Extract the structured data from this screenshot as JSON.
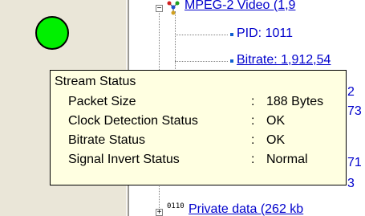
{
  "status_indicator": {
    "color": "#00f000",
    "state": "ok"
  },
  "tree": {
    "stream_node": {
      "label": "MPEG-2 Video (1,9",
      "icon": "network-node-icon"
    },
    "pid": {
      "label": "PID: 1011"
    },
    "bitrate": {
      "label": "Bitrate: 1,912,54"
    },
    "private_data": {
      "label": "Private data (262 kb",
      "icon": "binary-data-icon",
      "icon_text": "0110"
    },
    "partial_right": [
      "2",
      "73",
      "71",
      "3"
    ]
  },
  "tooltip": {
    "title": "Stream Status",
    "rows": [
      {
        "label": "Packet Size",
        "value": "188 Bytes"
      },
      {
        "label": "Clock Detection Status",
        "value": "OK"
      },
      {
        "label": "Bitrate Status",
        "value": "OK"
      },
      {
        "label": "Signal Invert Status",
        "value": "Normal"
      }
    ],
    "separator": ":"
  }
}
